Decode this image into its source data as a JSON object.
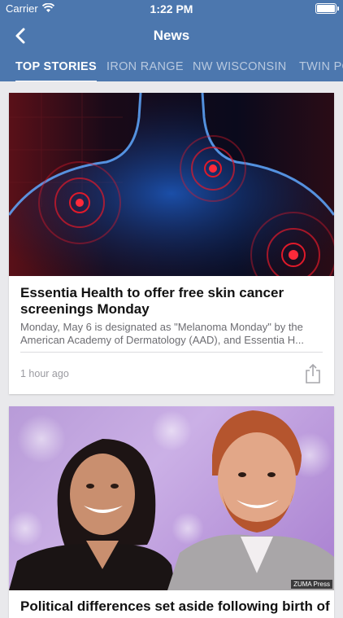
{
  "status_bar": {
    "carrier": "Carrier",
    "time": "1:22 PM"
  },
  "nav": {
    "title": "News"
  },
  "tabs": [
    {
      "label": "TOP STORIES",
      "active": true
    },
    {
      "label": "IRON RANGE",
      "active": false
    },
    {
      "label": "NW WISCONSIN",
      "active": false
    },
    {
      "label": "TWIN PO",
      "active": false
    }
  ],
  "articles": [
    {
      "headline_line1": "Essentia Health to offer free skin cancer",
      "headline_line2": "screenings Monday",
      "summary_line1": "Monday, May 6 is designated as \"Melanoma Monday\" by the",
      "summary_line2": "American Academy of Dermatology (AAD), and Essentia H...",
      "timestamp": "1 hour ago",
      "image_icon": "body-hotspots-illustration"
    },
    {
      "headline_line1": "Political differences set aside following birth of",
      "image_credit": "ZUMA Press",
      "image_icon": "royal-couple-photo"
    }
  ],
  "colors": {
    "header": "#4c77ae",
    "background": "#e9e9ec"
  }
}
